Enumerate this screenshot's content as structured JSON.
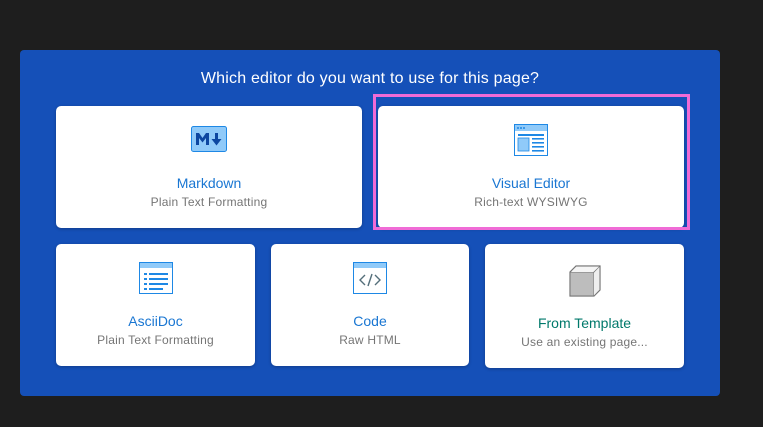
{
  "dialog": {
    "title": "Which editor do you want to use for this page?"
  },
  "editors": [
    {
      "label": "Markdown",
      "sub": "Plain Text Formatting",
      "icon": "markdown-icon"
    },
    {
      "label": "Visual Editor",
      "sub": "Rich-text WYSIWYG",
      "icon": "visual-editor-icon",
      "highlighted": true
    },
    {
      "label": "AsciiDoc",
      "sub": "Plain Text Formatting",
      "icon": "asciidoc-icon"
    },
    {
      "label": "Code",
      "sub": "Raw HTML",
      "icon": "code-icon"
    },
    {
      "label": "From Template",
      "sub": "Use an existing page...",
      "icon": "template-box-icon"
    }
  ],
  "colors": {
    "dialog_bg": "#1550b8",
    "label_blue": "#1976d2",
    "label_teal": "#00796b",
    "highlight": "#f06bd6"
  }
}
